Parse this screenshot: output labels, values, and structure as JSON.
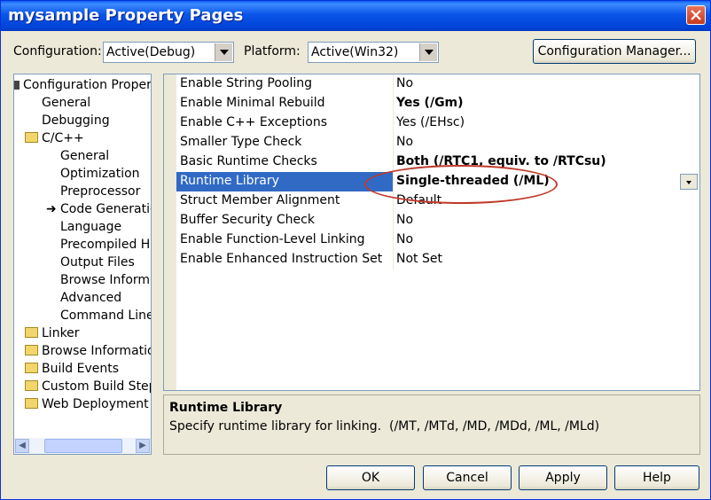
{
  "window": {
    "title": "mysample Property Pages"
  },
  "top": {
    "configuration_label": "Configuration:",
    "configuration_value": "Active(Debug)",
    "platform_label": "Platform:",
    "platform_value": "Active(Win32)",
    "config_manager_label": "Configuration Manager..."
  },
  "tree": {
    "root": "Configuration Properties",
    "general": "General",
    "debugging": "Debugging",
    "cpp": "C/C++",
    "cpp_items": [
      "General",
      "Optimization",
      "Preprocessor",
      "Code Generation",
      "Language",
      "Precompiled Headers",
      "Output Files",
      "Browse Information",
      "Advanced",
      "Command Line"
    ],
    "linker": "Linker",
    "browse_information": "Browse Information",
    "build_events": "Build Events",
    "custom_build_step": "Custom Build Step",
    "web_deployment": "Web Deployment"
  },
  "properties": [
    {
      "name": "Enable String Pooling",
      "value": "No"
    },
    {
      "name": "Enable Minimal Rebuild",
      "value": "Yes (/Gm)"
    },
    {
      "name": "Enable C++ Exceptions",
      "value": "Yes (/EHsc)"
    },
    {
      "name": "Smaller Type Check",
      "value": "No"
    },
    {
      "name": "Basic Runtime Checks",
      "value": "Both (/RTC1, equiv. to /RTCsu)"
    },
    {
      "name": "Runtime Library",
      "value": "Single-threaded (/ML)"
    },
    {
      "name": "Struct Member Alignment",
      "value": "Default"
    },
    {
      "name": "Buffer Security Check",
      "value": "No"
    },
    {
      "name": "Enable Function-Level Linking",
      "value": "No"
    },
    {
      "name": "Enable Enhanced Instruction Set",
      "value": "Not Set"
    }
  ],
  "description": {
    "title": "Runtime Library",
    "text": "Specify runtime library for linking.",
    "options": "(/MT, /MTd, /MD, /MDd, /ML, /MLd)"
  },
  "buttons": {
    "ok": "OK",
    "cancel": "Cancel",
    "apply": "Apply",
    "help": "Help"
  },
  "colors": {
    "selection": "#316ac5",
    "annotation": "#c0392b",
    "titlebar": "#0a55e8"
  }
}
